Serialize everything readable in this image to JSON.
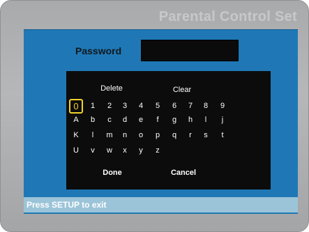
{
  "window": {
    "title": "Parental Control Set"
  },
  "password": {
    "label": "Password",
    "value": ""
  },
  "keypad": {
    "delete_label": "Delete",
    "clear_label": "Clear",
    "done_label": "Done",
    "cancel_label": "Cancel",
    "selected_key": "0",
    "rows": [
      [
        "0",
        "1",
        "2",
        "3",
        "4",
        "5",
        "6",
        "7",
        "8",
        "9"
      ],
      [
        "A",
        "b",
        "c",
        "d",
        "e",
        "f",
        "g",
        "h",
        "l",
        "j"
      ],
      [
        "K",
        "l",
        "m",
        "n",
        "o",
        "p",
        "q",
        "r",
        "s",
        "t"
      ],
      [
        "U",
        "v",
        "w",
        "x",
        "y",
        "z"
      ]
    ]
  },
  "footer": {
    "hint": "Press SETUP to exit"
  },
  "colors": {
    "panel": "#1f78b5",
    "keypad_bg": "#0c0c0c",
    "highlight": "#f4d22c",
    "footer_bar": "#9cc4d8"
  }
}
